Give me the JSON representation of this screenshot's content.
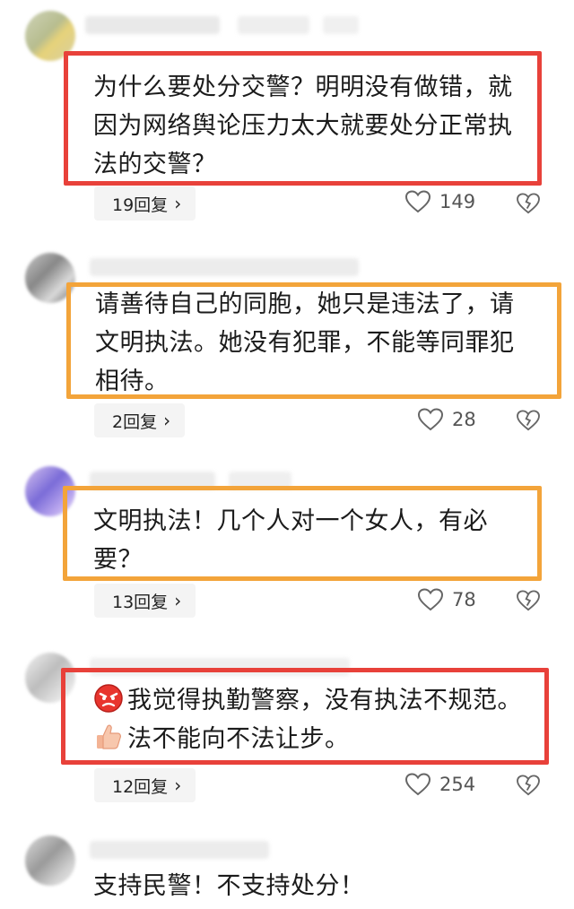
{
  "comments": [
    {
      "text_lines": [
        "为什么要处分交警？明明没有做错，就",
        "因为网络舆论压力太大就要处分正常执",
        "法的交警？"
      ],
      "replies_label": "19回复",
      "likes": "149",
      "box_color": "#e8413a"
    },
    {
      "text_lines": [
        "请善待自己的同胞，她只是违法了，请",
        "文明执法。她没有犯罪，不能等同罪犯",
        "相待。"
      ],
      "replies_label": "2回复",
      "likes": "28",
      "box_color": "#f3a43a"
    },
    {
      "text_lines": [
        "文明执法！几个人对一个女人，有必",
        "要？"
      ],
      "replies_label": "13回复",
      "likes": "78",
      "box_color": "#f3a43a"
    },
    {
      "text_lines": [
        "我觉得执勤警察，没有执法不规范。",
        "法不能向不法让步。"
      ],
      "line_icons": [
        "angry-face-icon",
        "thumbs-up-icon"
      ],
      "replies_label": "12回复",
      "likes": "254",
      "box_color": "#e8413a"
    },
    {
      "text_lines": [
        "支持民警！不支持处分！"
      ]
    }
  ],
  "icons": {
    "chevron": "›",
    "like": "heart-outline-icon",
    "dislike": "broken-heart-icon"
  }
}
